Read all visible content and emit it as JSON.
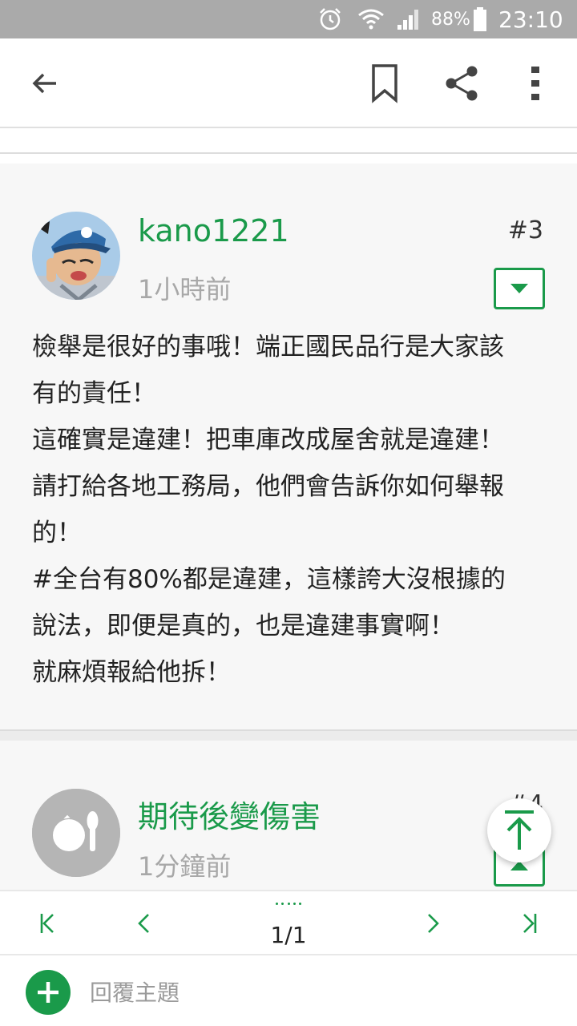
{
  "status_bar": {
    "battery_percent": "88%",
    "time": "23:10",
    "icons": [
      "alarm-icon",
      "wifi-icon",
      "signal-icon",
      "battery-icon"
    ]
  },
  "toolbar": {
    "icons": [
      "back-arrow-icon",
      "bookmark-icon",
      "share-icon",
      "more-vert-icon"
    ]
  },
  "posts": [
    {
      "author": "kano1221",
      "time": "1小時前",
      "floor": "#3",
      "content": "檢舉是很好的事哦！端正國民品行是大家該\n有的責任！\n這確實是違建！把車庫改成屋舍就是違建！\n請打給各地工務局，他們會告訴你如何舉報\n的！\n#全台有80%都是違建，這樣誇大沒根據的\n說法，即便是真的，也是違建事實啊！\n就麻煩報給他拆！"
    },
    {
      "author": "期待後變傷害",
      "time": "1分鐘前",
      "floor": "#4"
    }
  ],
  "pagination": {
    "page": "1/1"
  },
  "reply": {
    "placeholder": "回覆主題"
  },
  "colors": {
    "accent": "#1a9a4a",
    "statusbar": "#aaaaaa",
    "card_bg": "#f7f7f7"
  }
}
